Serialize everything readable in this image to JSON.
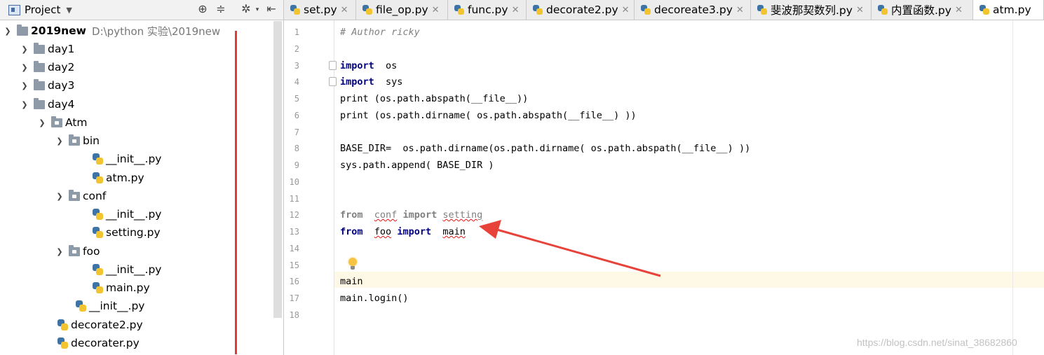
{
  "project_panel": {
    "title": "Project",
    "tree": [
      {
        "label": "2019new",
        "hint": "D:\\python 实验\\2019new",
        "kind": "folder",
        "expanded": true
      },
      {
        "label": "day1",
        "kind": "folder",
        "expanded": false
      },
      {
        "label": "day2",
        "kind": "folder",
        "expanded": false
      },
      {
        "label": "day3",
        "kind": "folder",
        "expanded": false
      },
      {
        "label": "day4",
        "kind": "folder",
        "expanded": true
      },
      {
        "label": "Atm",
        "kind": "package",
        "expanded": true
      },
      {
        "label": "bin",
        "kind": "package",
        "expanded": true
      },
      {
        "label": "__init__.py",
        "kind": "python"
      },
      {
        "label": "atm.py",
        "kind": "python"
      },
      {
        "label": "conf",
        "kind": "package",
        "expanded": true
      },
      {
        "label": "__init__.py",
        "kind": "python"
      },
      {
        "label": "setting.py",
        "kind": "python"
      },
      {
        "label": "foo",
        "kind": "package",
        "expanded": true
      },
      {
        "label": "__init__.py",
        "kind": "python"
      },
      {
        "label": "main.py",
        "kind": "python"
      },
      {
        "label": "__init__.py",
        "kind": "python"
      },
      {
        "label": "decorate2.py",
        "kind": "python"
      },
      {
        "label": "decorater.py",
        "kind": "python"
      }
    ]
  },
  "tabs": [
    {
      "label": "set.py"
    },
    {
      "label": "file_op.py"
    },
    {
      "label": "func.py"
    },
    {
      "label": "decorate2.py"
    },
    {
      "label": "decoreate3.py"
    },
    {
      "label": "斐波那契数列.py"
    },
    {
      "label": "内置函数.py"
    },
    {
      "label": "atm.py",
      "active": true
    }
  ],
  "editor": {
    "line_numbers": [
      "1",
      "2",
      "3",
      "4",
      "5",
      "6",
      "7",
      "8",
      "9",
      "10",
      "11",
      "12",
      "13",
      "14",
      "15",
      "16",
      "17",
      "18"
    ],
    "lines": {
      "l1": "# Author ricky",
      "l3_kw": "import",
      "l3_mod": "os",
      "l4_kw": "import",
      "l4_mod": "sys",
      "l5": "print (os.path.abspath(__file__))",
      "l6": "print (os.path.dirname( os.path.abspath(__file__) ))",
      "l8": "BASE_DIR=  os.path.dirname(os.path.dirname( os.path.abspath(__file__) ))",
      "l9": "sys.path.append( BASE_DIR )",
      "l12_from": "from",
      "l12_mod": "conf",
      "l12_import": "import",
      "l12_name": "setting",
      "l13_from": "from",
      "l13_mod": "foo",
      "l13_import": "import",
      "l13_name": "main",
      "l16": "main",
      "l17": "main.login()"
    },
    "current_line": "16",
    "annotation_arrow_color": "#e8433a"
  },
  "watermark": "https://blog.csdn.net/sinat_38682860"
}
